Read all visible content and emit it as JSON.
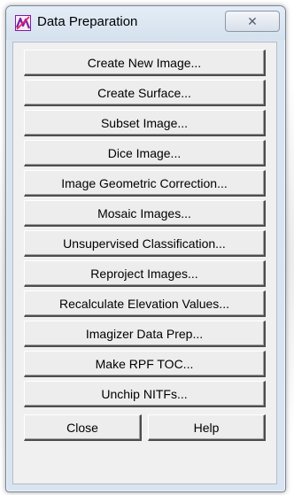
{
  "window": {
    "title": "Data Preparation",
    "close_glyph": "✕"
  },
  "buttons": [
    {
      "label": "Create New Image..."
    },
    {
      "label": "Create Surface..."
    },
    {
      "label": "Subset Image..."
    },
    {
      "label": "Dice Image..."
    },
    {
      "label": "Image Geometric Correction..."
    },
    {
      "label": "Mosaic Images..."
    },
    {
      "label": "Unsupervised Classification..."
    },
    {
      "label": "Reproject Images..."
    },
    {
      "label": "Recalculate Elevation Values..."
    },
    {
      "label": "Imagizer Data Prep..."
    },
    {
      "label": "Make RPF TOC..."
    },
    {
      "label": "Unchip NITFs..."
    }
  ],
  "footer": {
    "close_label": "Close",
    "help_label": "Help"
  },
  "icons": {
    "app": "data-preparation-icon",
    "close": "close-icon"
  },
  "colors": {
    "titlebar": "#dce6f2",
    "button_face": "#ededed",
    "icon_purple": "#7b1fa2"
  }
}
